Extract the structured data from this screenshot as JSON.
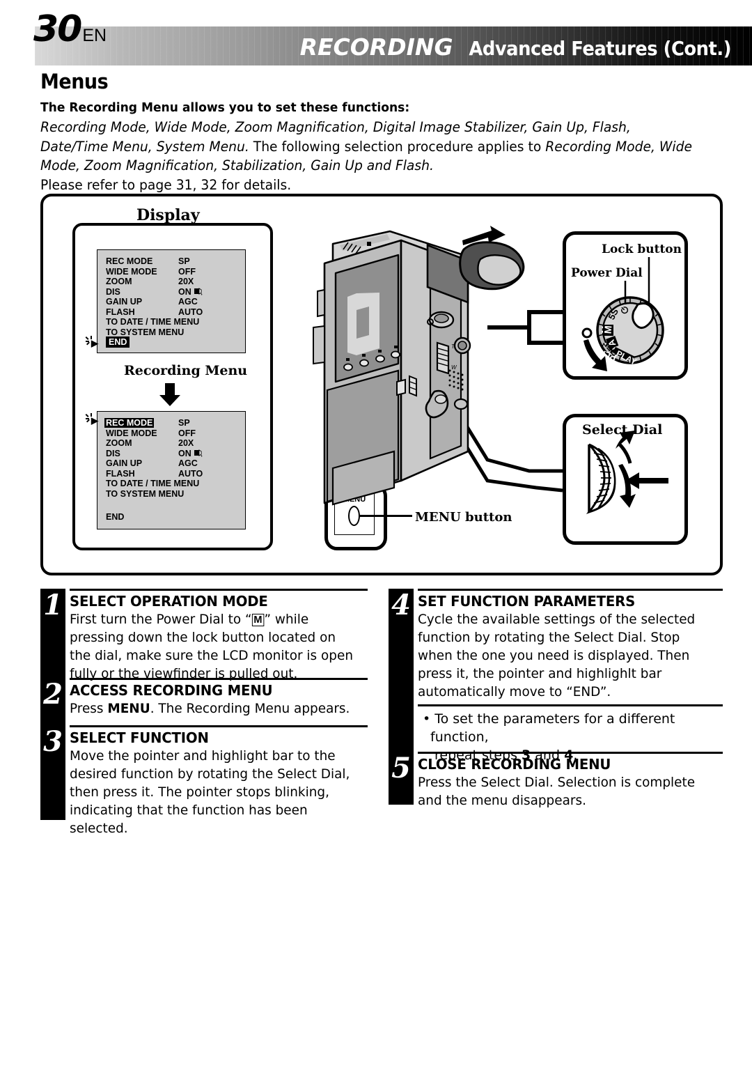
{
  "header": {
    "page_number": "30",
    "page_locale": "EN",
    "title_main": "RECORDING",
    "title_sub": "Advanced Features (Cont.)"
  },
  "section": {
    "title": "Menus",
    "lead": "The Recording Menu allows you to set these functions:",
    "body_line1_italic": "Recording Mode, Wide Mode, Zoom Magnification, Digital Image Stabilizer, Gain Up, Flash, Date/Time",
    "body_line2_italic_a": "Menu, System Menu.",
    "body_line2_plain": " The following selection procedure applies to ",
    "body_line2_italic_b": "Recording Mode, Wide Mode, Zoom",
    "body_line3_italic": "Magnification, Stabilization, Gain Up and Flash.",
    "body_line4": "Please refer to page 31, 32 for details."
  },
  "diagram": {
    "display_label": "Display",
    "recording_menu_caption": "Recording Menu",
    "menu_screen_1": {
      "rows": [
        {
          "label": "REC MODE",
          "value": "SP"
        },
        {
          "label": "WIDE MODE",
          "value": "OFF"
        },
        {
          "label": "ZOOM",
          "value": "20X"
        },
        {
          "label": "DIS",
          "value": "ON"
        },
        {
          "label": "GAIN UP",
          "value": "AGC"
        },
        {
          "label": "FLASH",
          "value": "AUTO"
        },
        {
          "label": "TO DATE / TIME MENU",
          "value": ""
        },
        {
          "label": "TO SYSTEM MENU",
          "value": ""
        }
      ],
      "end_label": "END",
      "end_highlighted": true,
      "pointer_glyph": "▶"
    },
    "menu_screen_2": {
      "rows": [
        {
          "label": "REC MODE",
          "value": "SP"
        },
        {
          "label": "WIDE MODE",
          "value": "OFF"
        },
        {
          "label": "ZOOM",
          "value": "20X"
        },
        {
          "label": "DIS",
          "value": "ON"
        },
        {
          "label": "GAIN UP",
          "value": "AGC"
        },
        {
          "label": "FLASH",
          "value": "AUTO"
        },
        {
          "label": "TO DATE / TIME MENU",
          "value": ""
        },
        {
          "label": "TO SYSTEM MENU",
          "value": ""
        }
      ],
      "end_label": "END",
      "end_highlighted": false,
      "highlighted_row_label": "REC MODE",
      "pointer_glyph": "▶"
    },
    "callouts": {
      "lock_button": "Lock button",
      "power_dial": "Power Dial",
      "select_dial": "Select Dial",
      "menu_button": "MENU button",
      "menu_button_face": "MENU"
    },
    "power_dial_positions": [
      "⏻",
      "5S",
      "M",
      "A",
      "OFF",
      "PLAY"
    ]
  },
  "steps": [
    {
      "number": "1",
      "title": "SELECT OPERATION MODE",
      "body_pre": "First turn the Power Dial to “",
      "body_badge": "M",
      "body_post": "” while pressing down the lock button located on the dial, make sure the LCD monitor is open fully or the viewfinder is pulled out."
    },
    {
      "number": "2",
      "title": "ACCESS RECORDING MENU",
      "body_pre": "Press ",
      "body_bold": "MENU",
      "body_post": ". The Recording Menu appears."
    },
    {
      "number": "3",
      "title": "SELECT FUNCTION",
      "body": "Move the pointer and highlight bar to the desired function by rotating the Select Dial, then press it. The pointer stops blinking, indicating that the function has been selected."
    },
    {
      "number": "4",
      "title": "SET FUNCTION PARAMETERS",
      "body": "Cycle the available settings of the selected function by rotating the Select Dial. Stop when the one you need is displayed. Then press it, the pointer and highlighlt bar automatically move to “END”."
    },
    {
      "number": "5",
      "title": "CLOSE RECORDING MENU",
      "body": "Press the Select Dial. Selection is complete and the menu disappears."
    }
  ],
  "bullet_note": {
    "line1": "• To set the parameters for a different function,",
    "line2_pre": "repeat steps ",
    "line2_b1": "3",
    "line2_mid": " and ",
    "line2_b2": "4",
    "line2_post": "."
  },
  "colors": {
    "ink": "#000000",
    "lcd_background": "#cdcdcd",
    "paper": "#ffffff"
  }
}
